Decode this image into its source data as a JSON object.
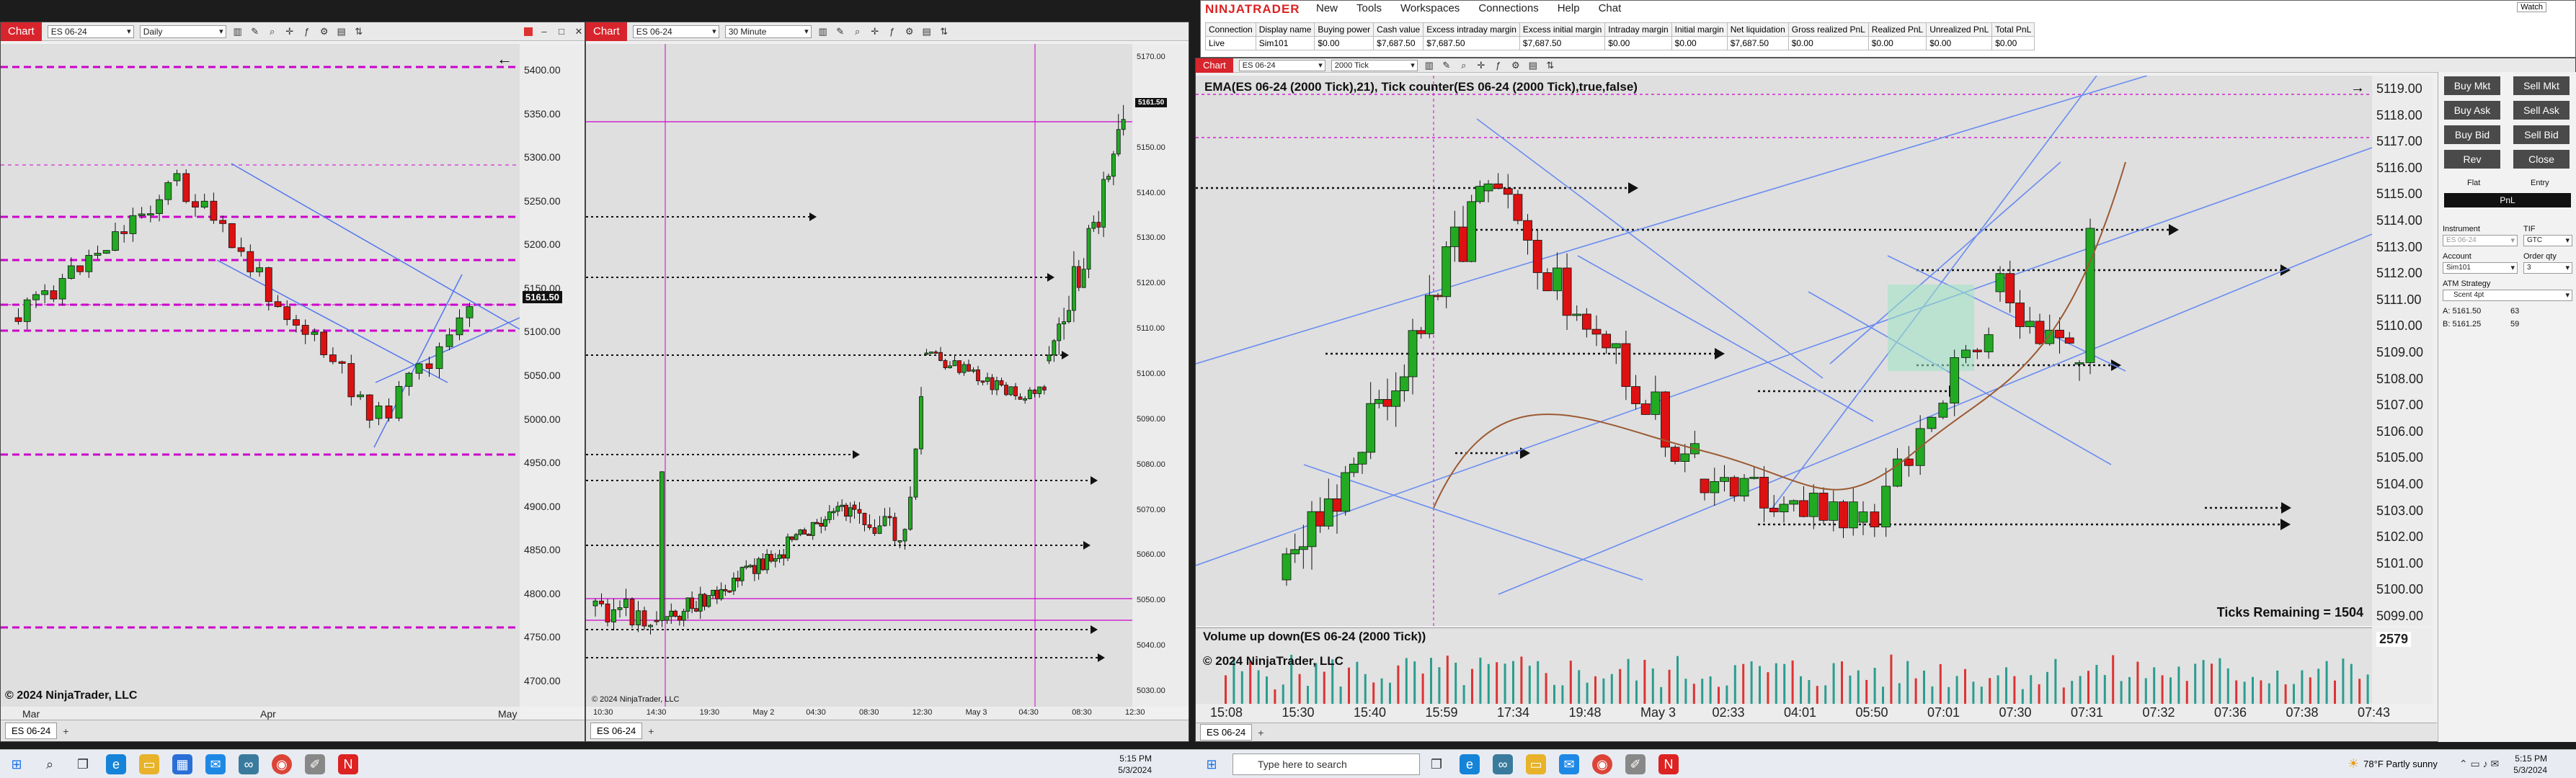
{
  "left_chart": {
    "tag": "Chart",
    "instrument": "ES 06-24",
    "period": "Daily",
    "y_ticks": [
      "5400.00",
      "5350.00",
      "5300.00",
      "5250.00",
      "5200.00",
      "5150.00",
      "5100.00",
      "5050.00",
      "5000.00",
      "4950.00",
      "4900.00",
      "4850.00",
      "4800.00",
      "4750.00",
      "4700.00"
    ],
    "x_ticks": [
      "Mar",
      "Apr",
      "May"
    ],
    "price_badge": "5161.50",
    "copyright": "© 2024 NinjaTrader, LLC",
    "tab": "ES 06-24"
  },
  "mid_chart": {
    "tag": "Chart",
    "instrument": "ES 06-24",
    "period": "30 Minute",
    "y_ticks": [
      "5170.00",
      "5160.00",
      "5150.00",
      "5140.00",
      "5130.00",
      "5120.00",
      "5110.00",
      "5100.00",
      "5090.00",
      "5080.00",
      "5070.00",
      "5060.00",
      "5050.00",
      "5040.00",
      "5030.00"
    ],
    "x_ticks": [
      "10:30",
      "14:30",
      "19:30",
      "May 2",
      "04:30",
      "08:30",
      "12:30",
      "May 3",
      "04:30",
      "08:30",
      "12:30"
    ],
    "price_badge": "5161.50",
    "copyright": "© 2024 NinjaTrader, LLC",
    "tab": "ES 06-24"
  },
  "account": {
    "logo": "NINJATRADER",
    "menu": [
      "New",
      "Tools",
      "Workspaces",
      "Connections",
      "Help",
      "Chat"
    ],
    "headers": [
      "Connection",
      "Display name",
      "Buying power",
      "Cash value",
      "Excess intraday margin",
      "Excess initial margin",
      "Intraday margin",
      "Initial margin",
      "Net liquidation",
      "Gross realized PnL",
      "Realized PnL",
      "Unrealized PnL",
      "Total PnL"
    ],
    "row": [
      "Live",
      "Sim101",
      "$0.00",
      "$7,687.50",
      "$7,687.50",
      "$7,687.50",
      "$0.00",
      "$0.00",
      "$7,687.50",
      "$0.00",
      "$0.00",
      "$0.00",
      "$0.00"
    ],
    "window_controls": "Watch"
  },
  "main_chart": {
    "tag": "Chart",
    "instrument": "ES 06-24",
    "period": "2000 Tick",
    "indicator_label": "EMA(ES 06-24 (2000 Tick),21), Tick counter(ES 06-24 (2000 Tick),true,false)",
    "y_ticks": [
      "5119.00",
      "5118.00",
      "5117.00",
      "5116.00",
      "5115.00",
      "5114.00",
      "5113.00",
      "5112.00",
      "5111.00",
      "5110.00",
      "5109.00",
      "5108.00",
      "5107.00",
      "5106.00",
      "5105.00",
      "5104.00",
      "5103.00",
      "5102.00",
      "5101.00",
      "5100.00",
      "5099.00"
    ],
    "x_ticks": [
      "15:08",
      "15:30",
      "15:40",
      "15:59",
      "17:34",
      "19:48",
      "May 3",
      "02:33",
      "04:01",
      "05:50",
      "07:01",
      "07:30",
      "07:31",
      "07:32",
      "07:36",
      "07:38",
      "07:43"
    ],
    "ticks_remaining": "Ticks Remaining = 1504",
    "volume_label": "Volume up down(ES 06-24 (2000 Tick))",
    "volume_value": "2579",
    "copyright": "© 2024 NinjaTrader, LLC",
    "tab": "ES 06-24"
  },
  "order_panel": {
    "buttons": [
      "Buy Mkt",
      "Sell Mkt",
      "Buy Ask",
      "Sell Ask",
      "Buy Bid",
      "Sell Bid",
      "Rev",
      "Close"
    ],
    "flat": "Flat",
    "entry": "Entry",
    "pnl": "PnL",
    "instrument_label": "Instrument",
    "instrument_value": "ES 06-24",
    "tif_label": "TIF",
    "tif_value": "GTC",
    "account_label": "Account",
    "account_value": "Sim101",
    "order_qty_label": "Order qty",
    "order_qty_value": "3",
    "atm_label": "ATM Strategy",
    "atm_value": "Scent 4pt",
    "ask": "A: 5161.50",
    "ask_size": "63",
    "bid": "B: 5161.25",
    "bid_size": "59"
  },
  "taskbar_left": {
    "time": "5:15 PM",
    "date": "5/3/2024"
  },
  "taskbar_right": {
    "search_placeholder": "Type here to search",
    "weather": "78°F  Partly sunny",
    "time": "5:15 PM",
    "date": "5/3/2024"
  }
}
